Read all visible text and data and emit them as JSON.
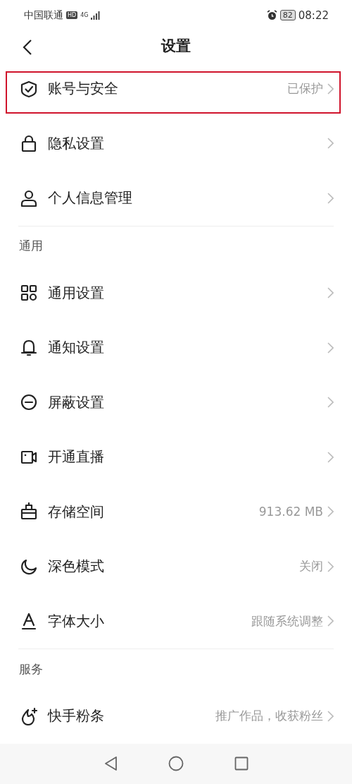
{
  "status_bar": {
    "carrier": "中国联通",
    "hd_badge": "HD",
    "network": "4G",
    "battery": "82",
    "time": "08:22"
  },
  "header": {
    "title": "设置"
  },
  "groups": [
    {
      "items": [
        {
          "label": "账号与安全",
          "value": "已保护",
          "highlighted": true
        },
        {
          "label": "隐私设置",
          "highlighted": false
        },
        {
          "label": "个人信息管理",
          "highlighted": false
        }
      ]
    },
    {
      "header": "通用",
      "items": [
        {
          "label": "通用设置",
          "highlighted": false
        },
        {
          "label": "通知设置",
          "highlighted": false
        },
        {
          "label": "屏蔽设置",
          "highlighted": false
        },
        {
          "label": "开通直播",
          "highlighted": false
        },
        {
          "label": "存储空间",
          "value": "913.62 MB",
          "highlighted": false
        },
        {
          "label": "深色模式",
          "value": "关闭",
          "highlighted": false
        },
        {
          "label": "字体大小",
          "value": "跟随系统调整",
          "highlighted": false
        }
      ]
    },
    {
      "header": "服务",
      "items": [
        {
          "label": "快手粉条",
          "value": "推广作品，收获粉丝",
          "highlighted": false
        }
      ]
    }
  ]
}
